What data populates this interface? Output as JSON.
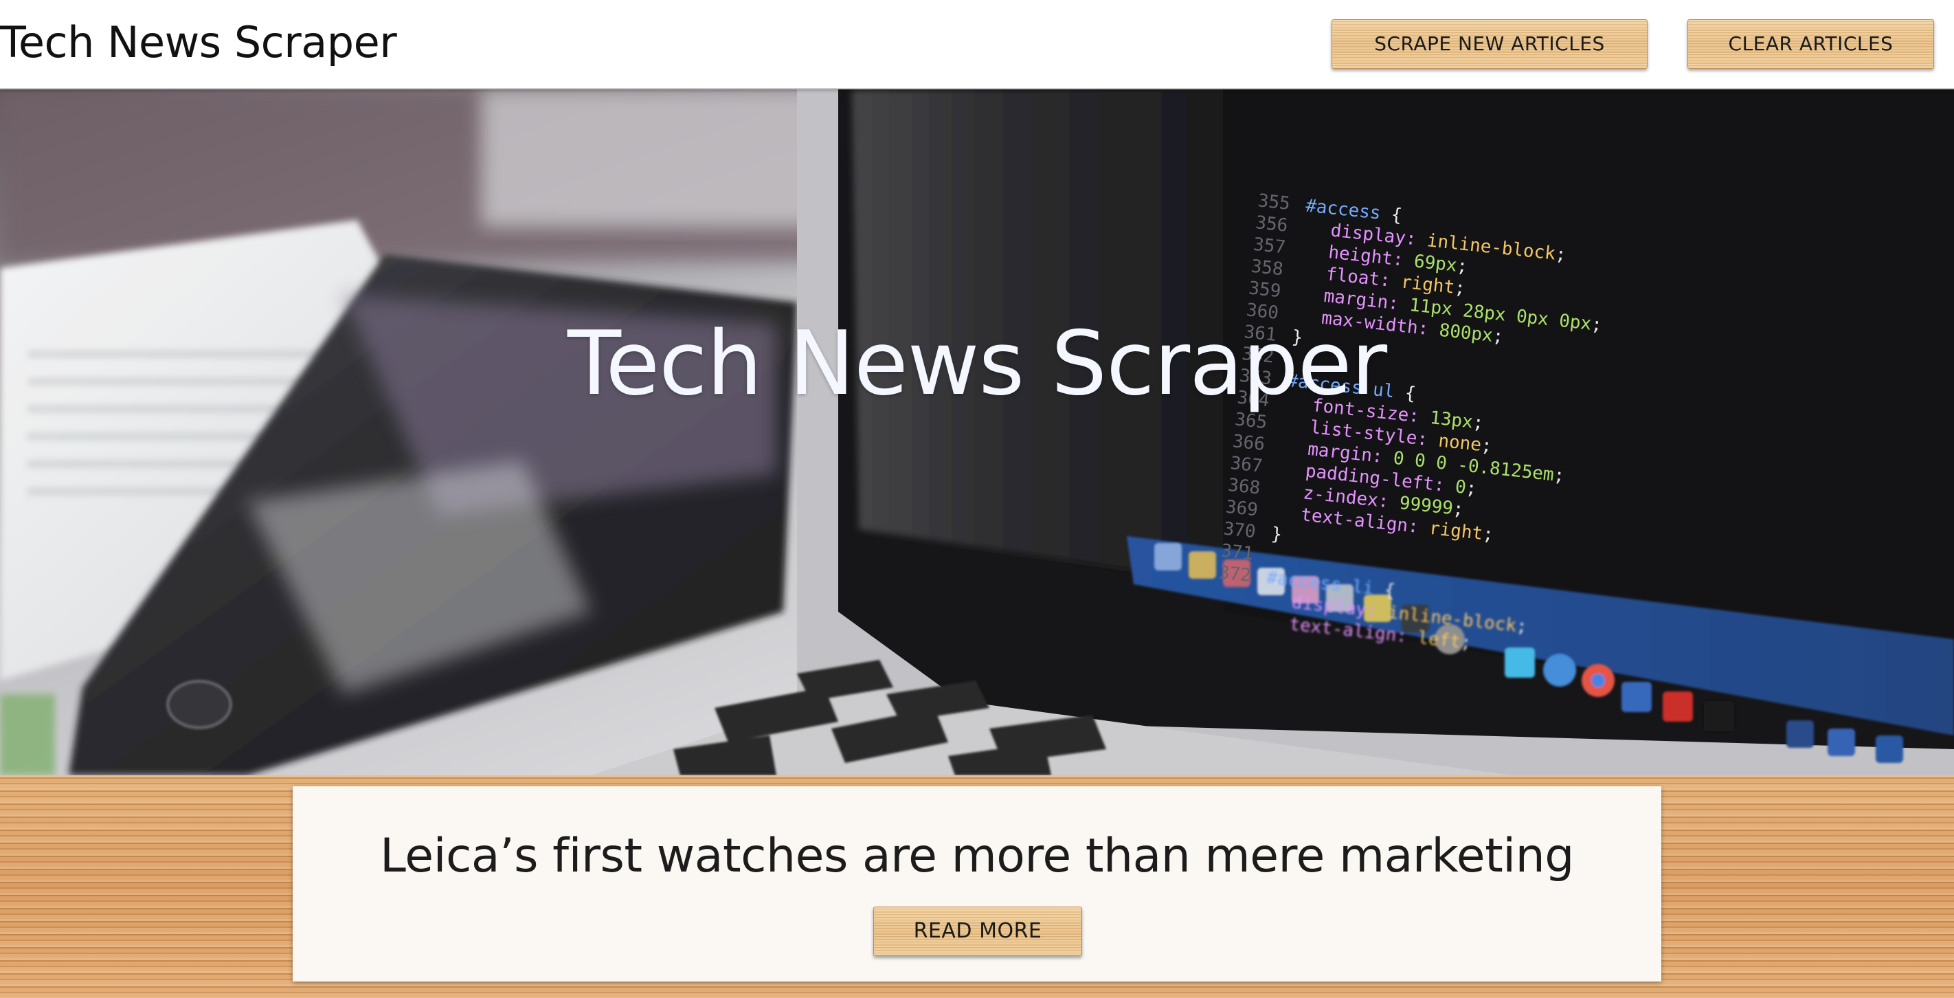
{
  "navbar": {
    "brand": "Tech News Scraper",
    "scrape_label": "SCRAPE NEW ARTICLES",
    "clear_label": "CLEAR ARTICLES"
  },
  "hero": {
    "title": "Tech News Scraper",
    "code_lines": [
      "#access {",
      "display: inline-block;",
      "height: 69px;",
      "float: right;",
      "margin: 11px 28px 0px 0px;",
      "max-width: 800px;",
      "}",
      "#access ul {",
      "font-size: 13px;",
      "list-style: none;",
      "margin: 0 0 0 -0.8125em;",
      "padding-left: 0;",
      "z-index: 99999;",
      "text-align: right;",
      "}",
      "#access li {",
      "display: inline-block;",
      "text-align: left;"
    ],
    "line_numbers": [
      "355",
      "356",
      "357",
      "358",
      "359",
      "360",
      "361",
      "362",
      "363",
      "364",
      "365",
      "366",
      "367",
      "368",
      "369",
      "370",
      "371",
      "372"
    ]
  },
  "articles": [
    {
      "title": "Leica’s first watches are more than mere marketing",
      "read_more_label": "READ MORE"
    }
  ],
  "colors": {
    "navbar_bg": "#ffffff",
    "wood_button": "#e8bf84",
    "hero_title": "#f4f7ff",
    "card_bg": "#fbf8f3"
  }
}
